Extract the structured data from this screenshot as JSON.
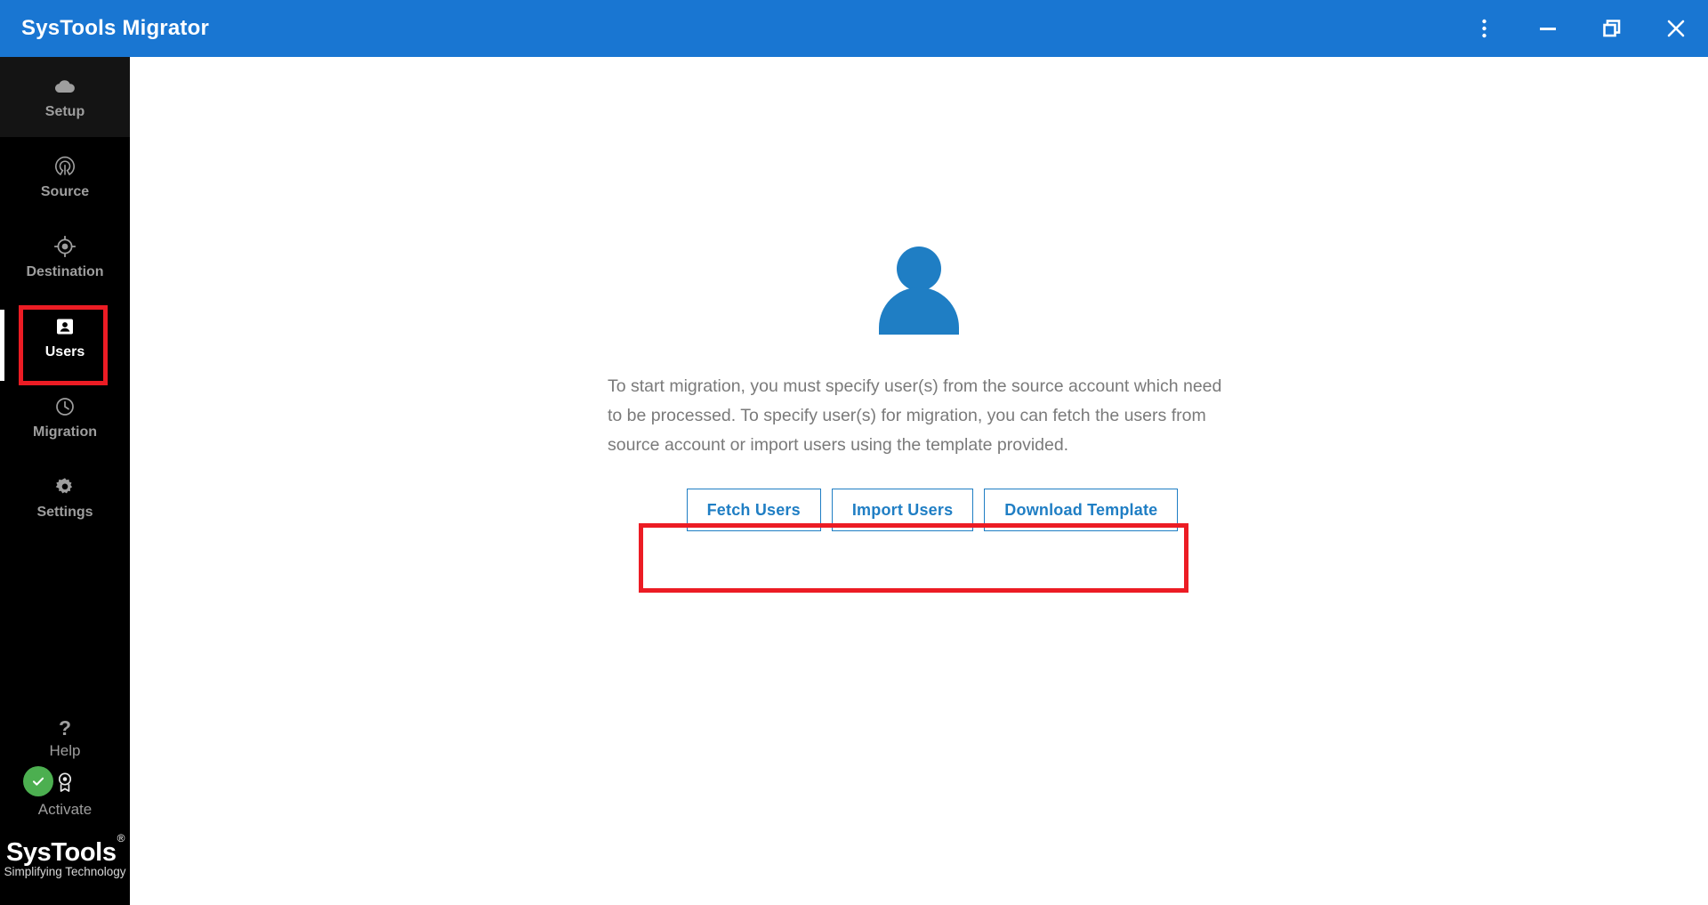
{
  "window": {
    "title": "SysTools Migrator",
    "accent_color": "#1976d2",
    "controls": [
      {
        "name": "more-options",
        "label": "More options",
        "icon": "kebab-menu-icon"
      },
      {
        "name": "minimize",
        "label": "Minimize",
        "icon": "minimize-icon"
      },
      {
        "name": "restore",
        "label": "Restore",
        "icon": "restore-icon"
      },
      {
        "name": "close",
        "label": "Close",
        "icon": "close-icon"
      }
    ]
  },
  "sidebar": {
    "background_color": "#000000",
    "items": [
      {
        "label": "Setup",
        "icon": "cloud-icon",
        "selected": false,
        "hover": true
      },
      {
        "label": "Source",
        "icon": "opensource-icon",
        "selected": false,
        "hover": false
      },
      {
        "label": "Destination",
        "icon": "target-icon",
        "selected": false,
        "hover": false
      },
      {
        "label": "Users",
        "icon": "user-card-icon",
        "selected": true,
        "hover": false
      },
      {
        "label": "Migration",
        "icon": "clock-icon",
        "selected": false,
        "hover": false
      },
      {
        "label": "Settings",
        "icon": "gear-icon",
        "selected": false,
        "hover": false
      }
    ],
    "bottom_items": [
      {
        "label": "Help",
        "icon": "question-mark-icon"
      },
      {
        "label": "Activate",
        "icon": "award-badge-icon",
        "status": "activated",
        "status_color": "#4caf50"
      }
    ],
    "brand": {
      "name": "SysTools",
      "registered_mark": "®",
      "tagline": "Simplifying Technology"
    }
  },
  "main": {
    "illustration": "user-silhouette-icon",
    "illustration_color": "#1f7ec4",
    "description": "To start migration, you must specify user(s) from the source account which need to be processed. To specify user(s) for migration, you can fetch the users from source account or import users using the template provided.",
    "actions": [
      {
        "label": "Fetch Users"
      },
      {
        "label": "Import Users"
      },
      {
        "label": "Download Template"
      }
    ]
  },
  "annotations": {
    "color": "#ec1c24",
    "boxes": [
      {
        "name": "users-nav-highlight"
      },
      {
        "name": "action-buttons-highlight"
      }
    ]
  }
}
